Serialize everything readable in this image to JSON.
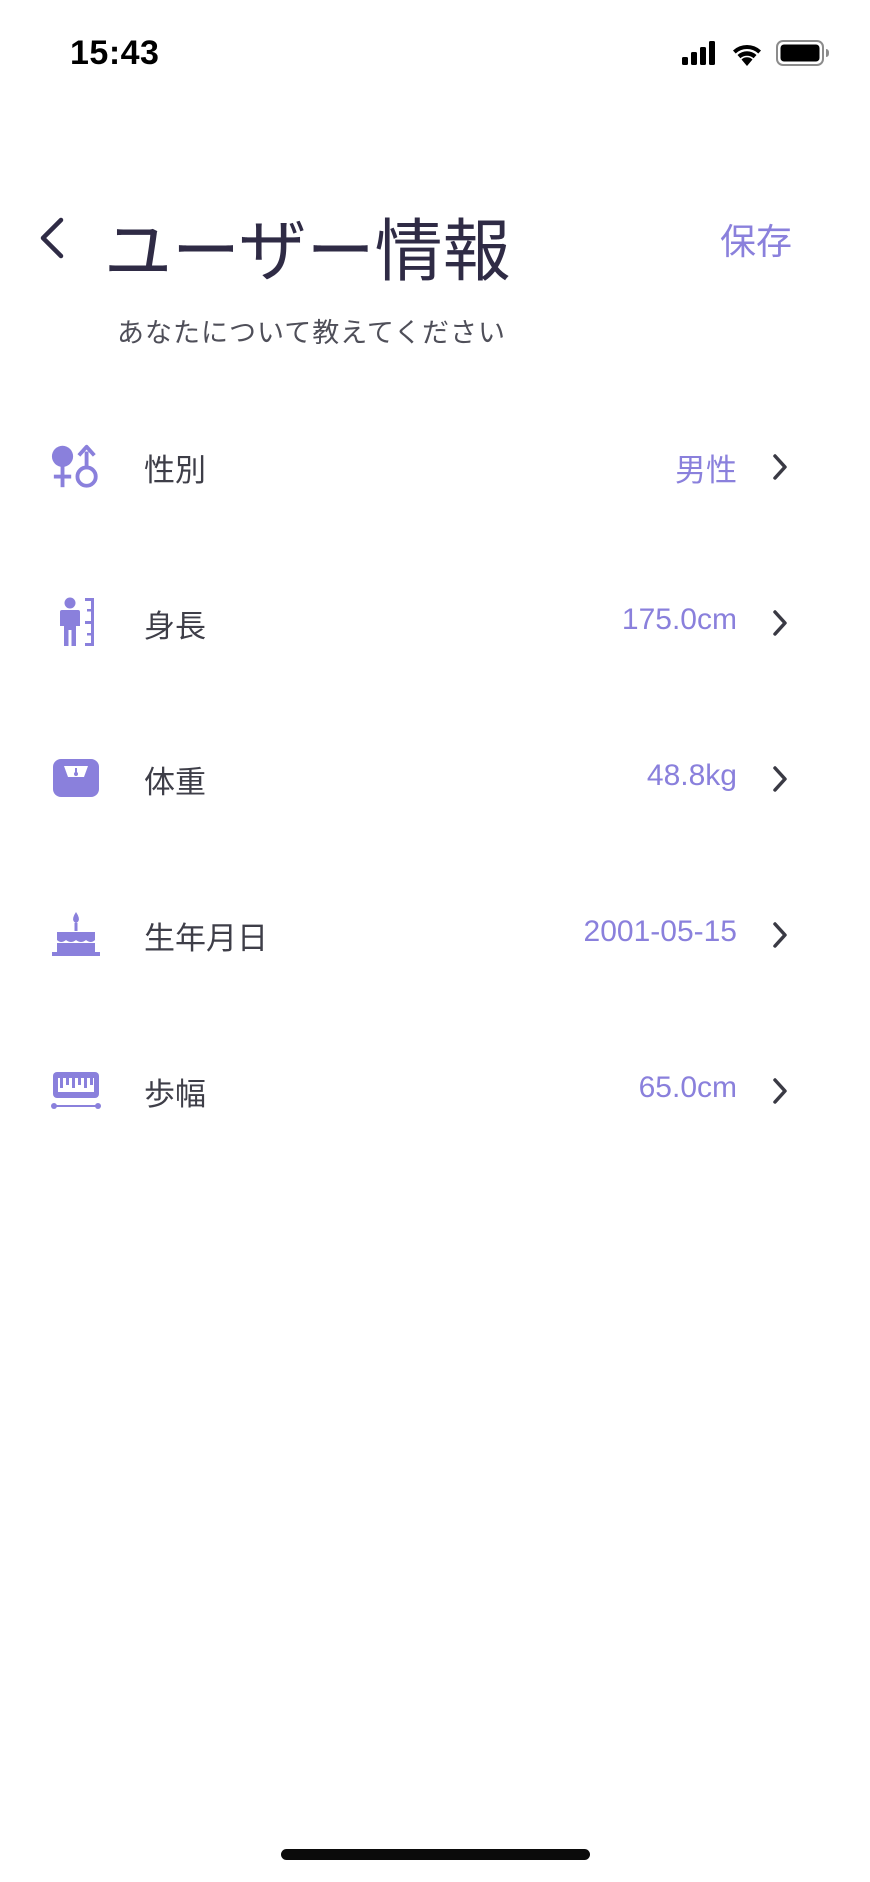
{
  "status_bar": {
    "time": "15:43",
    "signal_icon": "cellular-signal-icon",
    "wifi_icon": "wifi-icon",
    "battery_icon": "battery-icon"
  },
  "header": {
    "back_icon": "chevron-left-icon",
    "title": "ユーザー情報",
    "save_label": "保存",
    "subtitle": "あなたについて教えてください"
  },
  "rows": [
    {
      "icon": "gender-icon",
      "label": "性別",
      "value": "男性"
    },
    {
      "icon": "height-icon",
      "label": "身長",
      "value": "175.0cm"
    },
    {
      "icon": "scale-icon",
      "label": "体重",
      "value": "48.8kg"
    },
    {
      "icon": "birthday-cake-icon",
      "label": "生年月日",
      "value": "2001-05-15"
    },
    {
      "icon": "ruler-icon",
      "label": "歩幅",
      "value": "65.0cm"
    }
  ],
  "colors": {
    "accent": "#8a80dc",
    "title": "#2f2b45",
    "label": "#3e3e48",
    "subtitle": "#4f4f59",
    "chevron": "#3a3a44",
    "background": "#ffffff"
  }
}
